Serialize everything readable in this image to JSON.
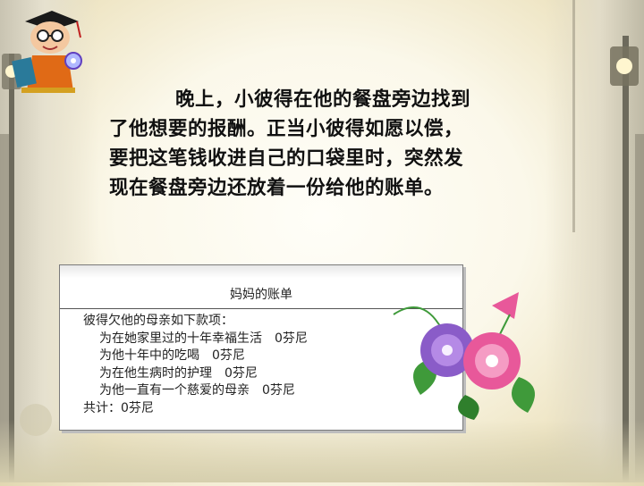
{
  "story": {
    "lines": [
      "晚上，小彼得在他的餐盘旁边找到",
      "了他想要的报酬。正当小彼得如愿以偿，",
      "要把这笔钱收进自己的口袋里时，突然发",
      "现在餐盘旁边还放着一份给他的账单。"
    ]
  },
  "bill": {
    "title": "妈妈的账单",
    "intro": "彼得欠他的母亲如下款项：",
    "items": [
      "为在她家里过的十年幸福生活　0芬尼",
      "为他十年中的吃喝　0芬尼",
      "为在他生病时的护理　0芬尼",
      "为他一直有一个慈爱的母亲　0芬尼"
    ],
    "total": "共计：0芬尼"
  },
  "colors": {
    "flower_pink": "#e8589a",
    "flower_purple": "#8a5cc8",
    "leaf": "#3f9a3a"
  }
}
